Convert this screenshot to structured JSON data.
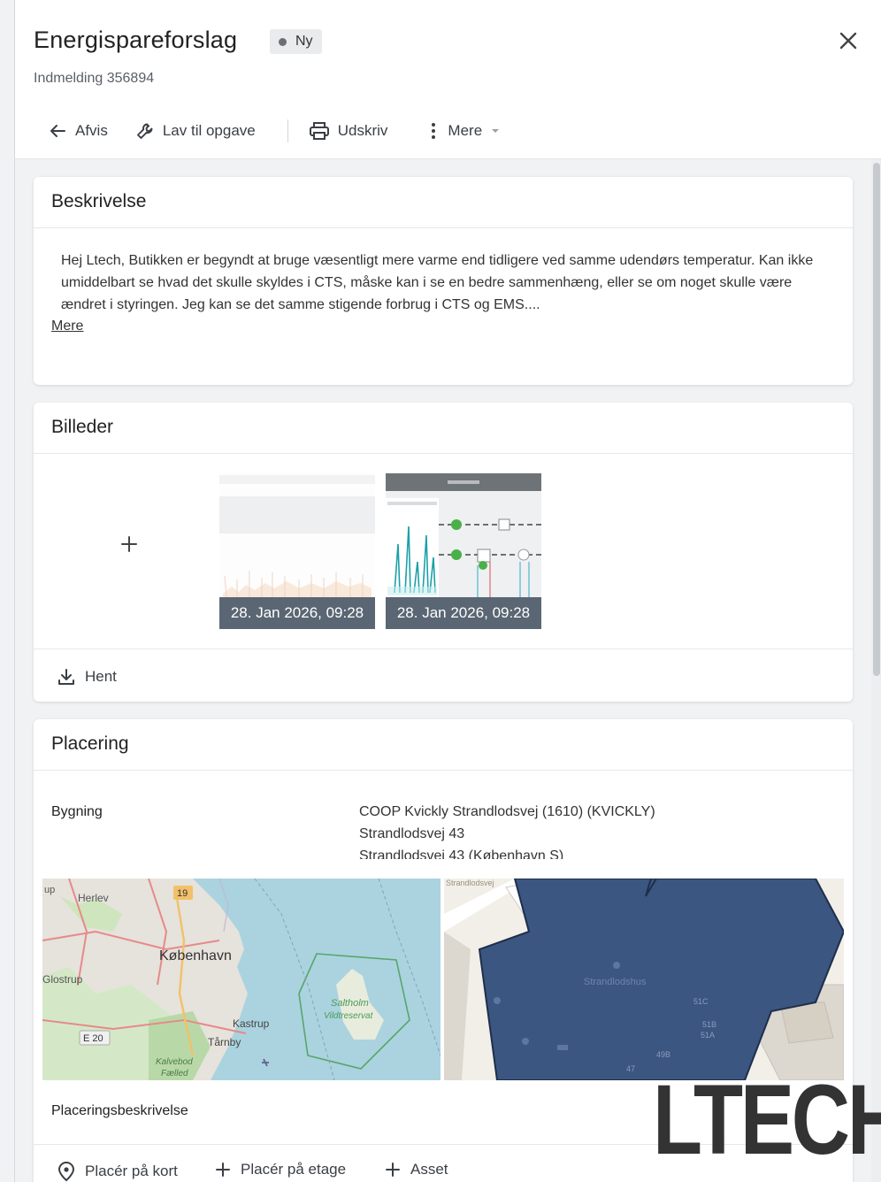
{
  "header": {
    "title": "Energispareforslag",
    "status_badge": "Ny",
    "subtitle": "Indmelding 356894"
  },
  "toolbar": {
    "reject": "Afvis",
    "make_task": "Lav til opgave",
    "print": "Udskriv",
    "more": "Mere"
  },
  "description": {
    "heading": "Beskrivelse",
    "text": "Hej Ltech, Butikken er begyndt at bruge væsentligt mere varme end tidligere ved samme udendørs temperatur. Kan ikke umiddelbart se hvad det skulle skyldes i CTS, måske kan i se en bedre sammenhæng, eller se om noget skulle være ændret i styringen. Jeg kan se det samme stigende forbrug i CTS og EMS....",
    "more_link": "Mere"
  },
  "images": {
    "heading": "Billeder",
    "items": [
      {
        "caption": "28. Jan 2026, 09:28"
      },
      {
        "caption": "28. Jan 2026, 09:28"
      }
    ],
    "download": "Hent"
  },
  "location": {
    "heading": "Placering",
    "building_label": "Bygning",
    "building_lines": [
      "COOP Kvickly Strandlodsvej (1610) (KVICKLY)",
      "Strandlodsvej 43",
      "Strandlodsvej 43 (København S)"
    ],
    "overview_map": {
      "places": {
        "herlev": "Herlev",
        "copenhagen": "København",
        "glostrup": "Glostrup",
        "kastrup": "Kastrup",
        "taarnby": "Tårnby",
        "saltholm": "Saltholm",
        "reserve": "Vildtreservat",
        "kalvebod1": "Kalvebod",
        "kalvebod2": "Fælled",
        "road19": "19",
        "roadE20": "E 20",
        "up": "up"
      }
    },
    "detail_map": {
      "building_name": "Strandlodshus",
      "street": "Strandlodsvej",
      "numbers": [
        "51C",
        "51B",
        "51A",
        "49B",
        "47"
      ]
    },
    "placement_description_label": "Placeringsbeskrivelse",
    "actions": {
      "place_on_map": "Placér på kort",
      "place_on_floor": "Placér på etage",
      "asset": "Asset"
    }
  },
  "watermark": "LTECH",
  "colors": {
    "accent": "#3a3f45",
    "badge_bg": "#e9ebed",
    "caption_bg": "#5a6673",
    "building_fill": "#3b5680"
  }
}
